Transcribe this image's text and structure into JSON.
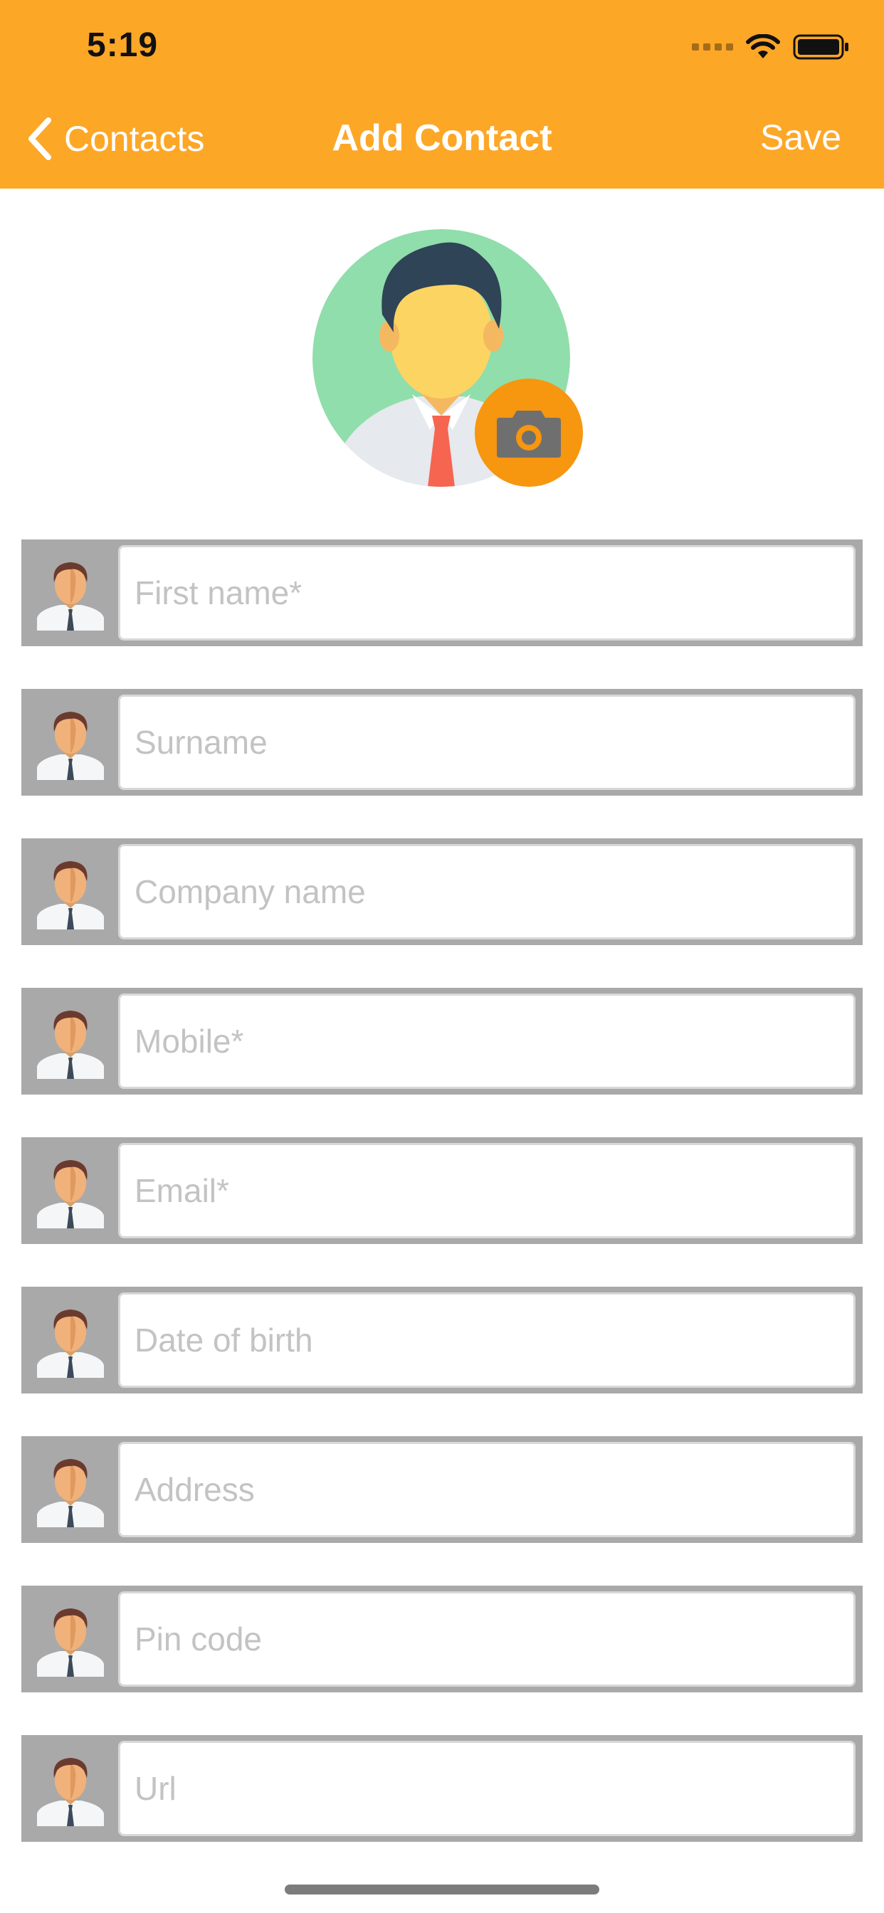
{
  "status_bar": {
    "time": "5:19"
  },
  "nav": {
    "back_label": "Contacts",
    "title": "Add Contact",
    "save_label": "Save"
  },
  "colors": {
    "header": "#FDA727",
    "camera_button": "#F7960F",
    "field_row_bg": "#A9A9A9",
    "placeholder_text": "#C3C3C3"
  },
  "avatar": {
    "icon": "person-avatar-icon",
    "camera_icon": "camera-icon"
  },
  "fields": [
    {
      "name": "first-name",
      "placeholder": "First name*",
      "value": ""
    },
    {
      "name": "surname",
      "placeholder": "Surname",
      "value": ""
    },
    {
      "name": "company-name",
      "placeholder": "Company name",
      "value": ""
    },
    {
      "name": "mobile",
      "placeholder": "Mobile*",
      "value": ""
    },
    {
      "name": "email",
      "placeholder": "Email*",
      "value": ""
    },
    {
      "name": "date-of-birth",
      "placeholder": "Date of birth",
      "value": ""
    },
    {
      "name": "address",
      "placeholder": "Address",
      "value": ""
    },
    {
      "name": "pin-code",
      "placeholder": "Pin code",
      "value": ""
    },
    {
      "name": "url",
      "placeholder": "Url",
      "value": ""
    }
  ]
}
